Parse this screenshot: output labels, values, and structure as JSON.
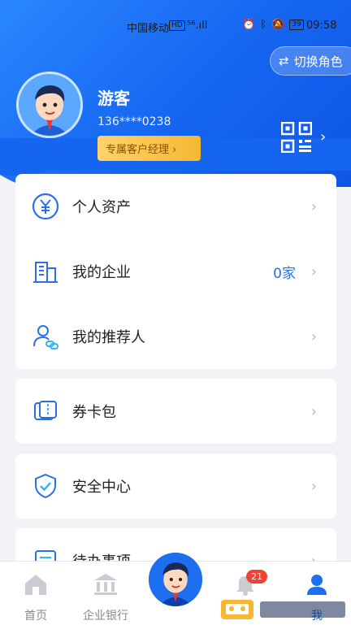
{
  "statusbar": {
    "carrier": "中国移动",
    "hd": "HD",
    "signal": "⁵⁶.ıll",
    "battery": "39",
    "time": "09:58"
  },
  "header": {
    "switch_role_label": "切换角色",
    "username": "游客",
    "phone": "136****0238",
    "manager_button": "专属客户经理 ›"
  },
  "menu_groups": [
    [
      {
        "label": "个人资产",
        "value": "",
        "icon": "yuan-circle-icon"
      },
      {
        "label": "我的企业",
        "value": "0家",
        "icon": "building-icon"
      },
      {
        "label": "我的推荐人",
        "value": "",
        "icon": "person-link-icon"
      }
    ],
    [
      {
        "label": "券卡包",
        "value": "",
        "icon": "coupon-icon"
      }
    ],
    [
      {
        "label": "安全中心",
        "value": "",
        "icon": "shield-check-icon"
      }
    ],
    [
      {
        "label": "待办事项",
        "value": "",
        "icon": "todo-icon"
      }
    ]
  ],
  "bottom_nav": {
    "home_label": "首页",
    "bank_label": "企业银行",
    "mine_label": "我",
    "notification_count": "21"
  },
  "colors": {
    "brand_blue": "#1565f0",
    "accent_gold": "#f7b733",
    "value_blue": "#2b6fe6"
  }
}
